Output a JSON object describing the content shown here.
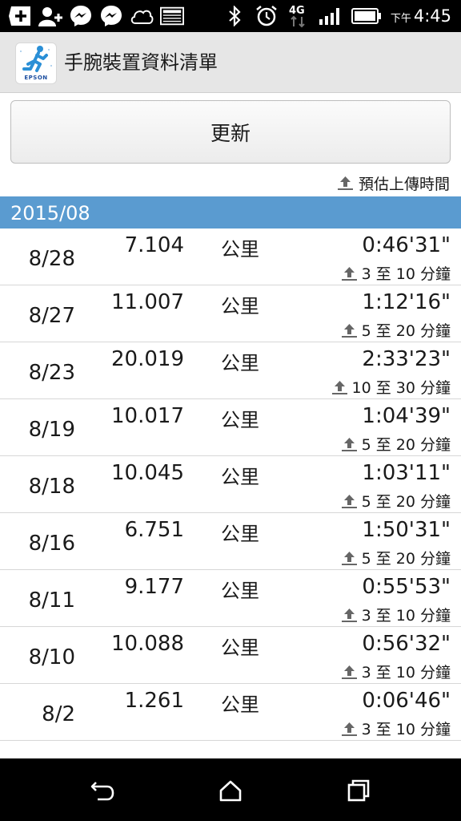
{
  "status_bar": {
    "icons": [
      "add-box-icon",
      "add-contact-icon",
      "messenger-icon",
      "messenger-icon",
      "cloud-icon",
      "news-icon",
      "bluetooth-icon",
      "alarm-icon",
      "4g-data-icon",
      "signal-icon",
      "battery-icon"
    ],
    "network_label": "4G",
    "time_prefix": "下午",
    "time": "4:45"
  },
  "app_bar": {
    "logo_brand": "EPSON",
    "title": "手腕裝置資料清單"
  },
  "refresh_label": "更新",
  "upload_header_label": "預估上傳時間",
  "month": "2015/08",
  "unit_label": "公里",
  "records": [
    {
      "date": "8/28",
      "distance": "7.104",
      "duration": "0:46'31\"",
      "estimate": "3 至 10 分鐘"
    },
    {
      "date": "8/27",
      "distance": "11.007",
      "duration": "1:12'16\"",
      "estimate": "5 至 20 分鐘"
    },
    {
      "date": "8/23",
      "distance": "20.019",
      "duration": "2:33'23\"",
      "estimate": "10 至 30 分鐘"
    },
    {
      "date": "8/19",
      "distance": "10.017",
      "duration": "1:04'39\"",
      "estimate": "5 至 20 分鐘"
    },
    {
      "date": "8/18",
      "distance": "10.045",
      "duration": "1:03'11\"",
      "estimate": "5 至 20 分鐘"
    },
    {
      "date": "8/16",
      "distance": "6.751",
      "duration": "1:50'31\"",
      "estimate": "5 至 20 分鐘"
    },
    {
      "date": "8/11",
      "distance": "9.177",
      "duration": "0:55'53\"",
      "estimate": "3 至 10 分鐘"
    },
    {
      "date": "8/10",
      "distance": "10.088",
      "duration": "0:56'32\"",
      "estimate": "3 至 10 分鐘"
    },
    {
      "date": "8/2",
      "distance": "1.261",
      "duration": "0:06'46\"",
      "estimate": "3 至 10 分鐘"
    }
  ],
  "nav_bar": {
    "icons": [
      "back-icon",
      "home-icon",
      "recents-icon"
    ]
  },
  "colors": {
    "month_header_bg": "#5a9bd0",
    "app_bar_bg": "#e6e6e6",
    "logo_runner": "#2a8fd6"
  }
}
